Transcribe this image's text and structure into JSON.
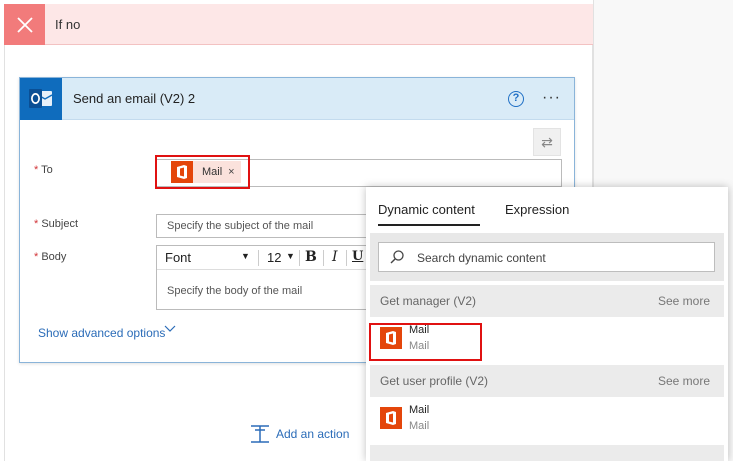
{
  "if_no": {
    "title": "If no"
  },
  "card": {
    "title": "Send an email (V2) 2",
    "help_symbol": "?",
    "more_symbol": "···",
    "swap_symbol": "⇄"
  },
  "fields": {
    "required_mark": "*",
    "to_label": "To",
    "subject_label": "Subject",
    "body_label": "Body",
    "to_token": {
      "label": "Mail",
      "remove": "×"
    },
    "subject_placeholder": "Specify the subject of the mail",
    "body_placeholder": "Specify the body of the mail"
  },
  "toolbar": {
    "font": "Font",
    "size": "12",
    "caret": "▼",
    "bold": "B",
    "italic": "I",
    "underline": "U"
  },
  "advanced_options": "Show advanced options",
  "add_action": "Add an action",
  "dynamic_panel": {
    "tabs": [
      "Dynamic content",
      "Expression"
    ],
    "search_placeholder": "Search dynamic content",
    "groups": [
      {
        "title": "Get manager (V2)",
        "see_more": "See more",
        "items": [
          {
            "name": "Mail",
            "sub": "Mail"
          }
        ]
      },
      {
        "title": "Get user profile (V2)",
        "see_more": "See more",
        "items": [
          {
            "name": "Mail",
            "sub": "Mail"
          }
        ]
      }
    ]
  },
  "colors": {
    "office_orange": "#e4460b",
    "outlook_blue": "#0f6cbd",
    "link_blue": "#2b6cb8",
    "highlight_red": "#e01111",
    "ifno_red": "#f27b7b"
  }
}
